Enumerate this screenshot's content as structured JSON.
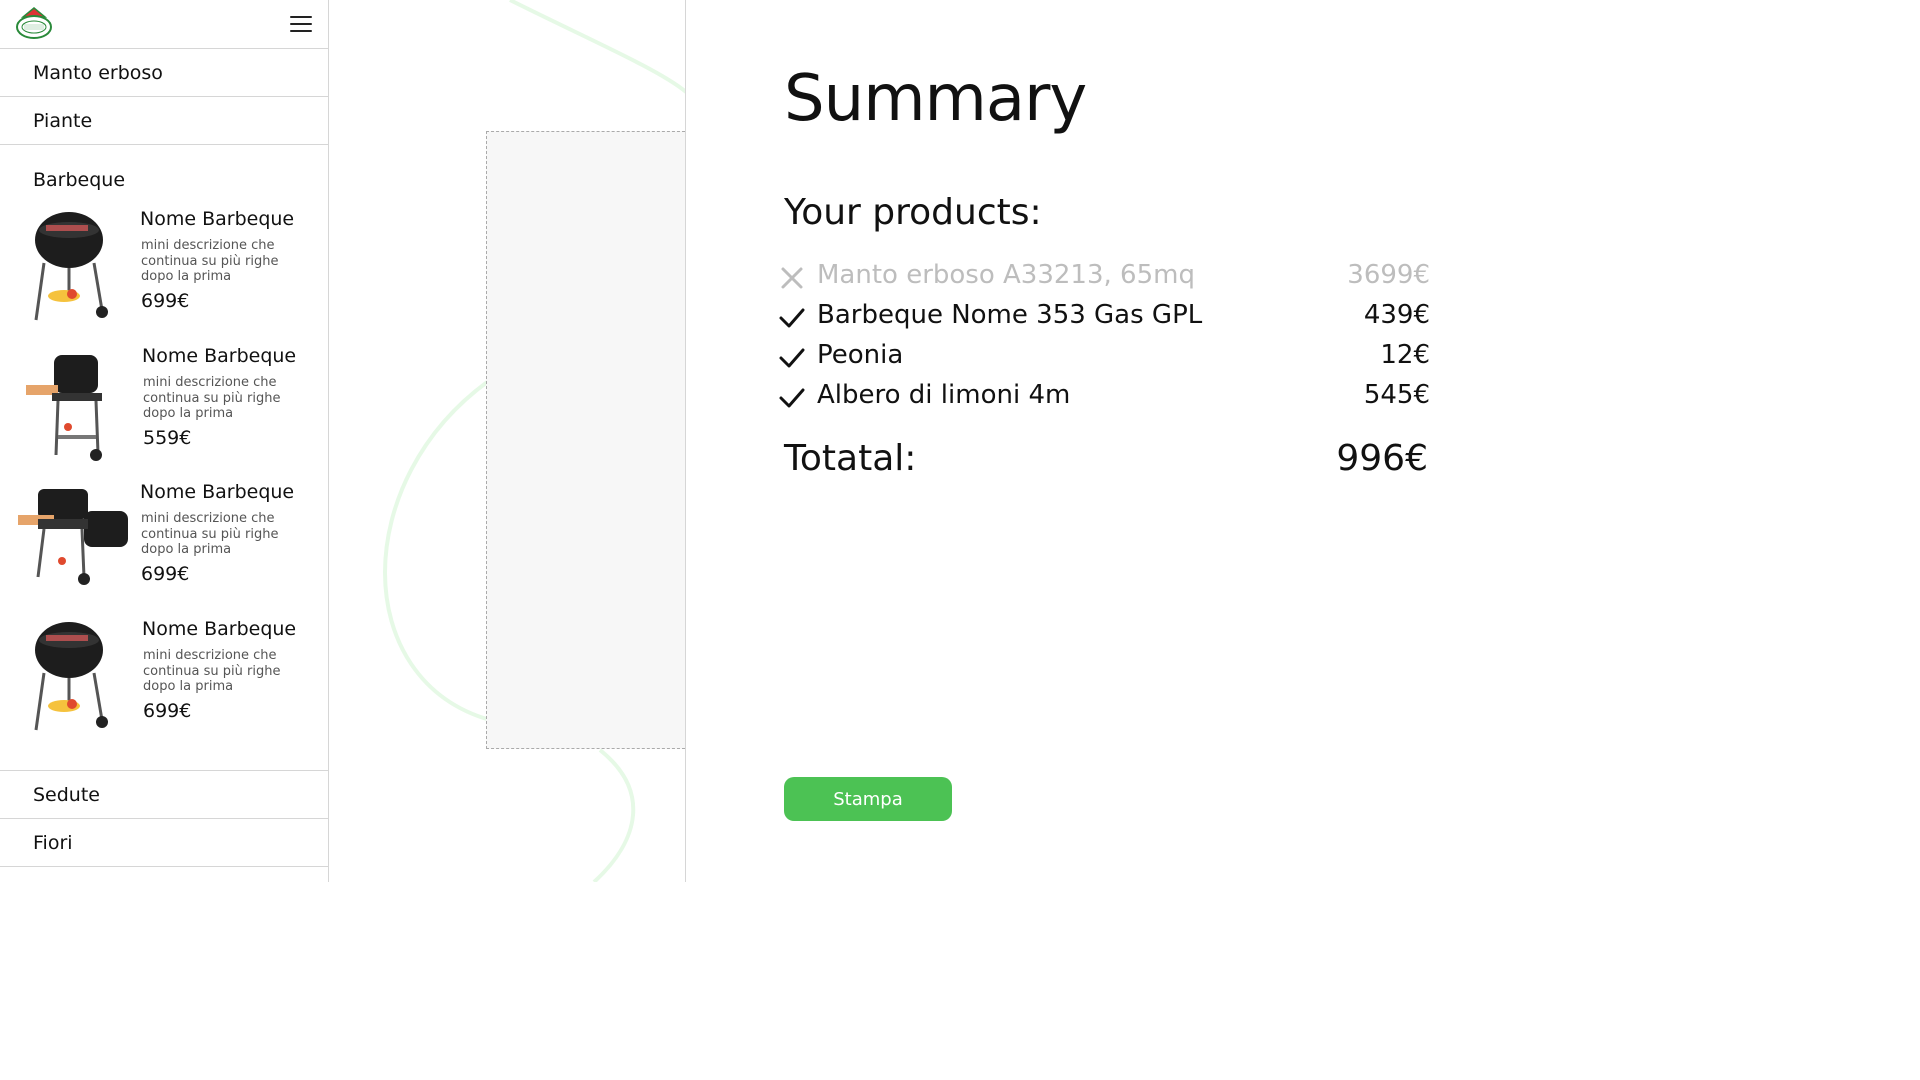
{
  "sidebar": {
    "categories_top": [
      "Manto erboso",
      "Piante",
      "Barbeque"
    ],
    "products": [
      {
        "name": "Nome Barbeque",
        "desc": "mini descrizione che continua su più righe dopo la prima",
        "price": "699€"
      },
      {
        "name": "Nome Barbeque",
        "desc": "mini descrizione che continua su più righe dopo la prima",
        "price": "559€"
      },
      {
        "name": "Nome Barbeque",
        "desc": "mini descrizione che continua su più righe dopo la prima",
        "price": "699€"
      },
      {
        "name": "Nome Barbeque",
        "desc": "mini descrizione che continua su più righe dopo la prima",
        "price": "699€"
      }
    ],
    "categories_bottom": [
      "Sedute",
      "Fiori"
    ]
  },
  "summary": {
    "title": "Summary",
    "subtitle": "Your products:",
    "items": [
      {
        "label": "Manto erboso A33213, 65mq",
        "price": "3699€",
        "status": "removed",
        "icon": "x-icon"
      },
      {
        "label": "Barbeque Nome 353 Gas GPL",
        "price": "439€",
        "status": "included",
        "icon": "check-icon"
      },
      {
        "label": "Peonia",
        "price": "12€",
        "status": "included",
        "icon": "check-icon"
      },
      {
        "label": "Albero di limoni 4m",
        "price": "545€",
        "status": "included",
        "icon": "check-icon"
      }
    ],
    "total_label": "Totatal:",
    "total_value": "996€",
    "print_button": "Stampa"
  },
  "colors": {
    "accent": "#4cc254",
    "removed_text": "#bdbdbd",
    "curve": "#e6f9e6"
  }
}
